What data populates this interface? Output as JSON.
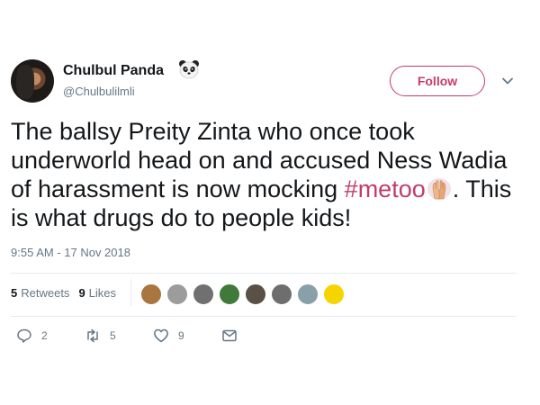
{
  "author": {
    "name": "Chulbul Panda",
    "name_emoji": "panda-face-icon",
    "handle": "@Chulbulilmli"
  },
  "follow_label": "Follow",
  "tweet": {
    "text_before": "The ballsy Preity Zinta who once took underworld head on and accused Ness Wadia of harassment is now mocking ",
    "hashtag": "#metoo",
    "hashtag_emoji": "raised-hands-icon",
    "text_after": ". This is what drugs do to people kids!"
  },
  "timestamp": "9:55 AM - 17 Nov 2018",
  "stats": {
    "retweets_count": "5",
    "retweets_label": "Retweets",
    "likes_count": "9",
    "likes_label": "Likes"
  },
  "likers": [
    {
      "icon": "liker-avatar-1",
      "color": "#a8763e"
    },
    {
      "icon": "liker-avatar-2",
      "color": "#9c9c9c"
    },
    {
      "icon": "liker-avatar-3",
      "color": "#707070"
    },
    {
      "icon": "liker-avatar-4",
      "color": "#3f7a3a"
    },
    {
      "icon": "liker-avatar-5",
      "color": "#5a5046"
    },
    {
      "icon": "liker-avatar-6",
      "color": "#6e6e6e"
    },
    {
      "icon": "liker-avatar-7",
      "color": "#8aa0a8"
    },
    {
      "icon": "liker-avatar-8",
      "color": "#f5d400"
    }
  ],
  "actions": {
    "reply_count": "2",
    "retweet_count": "5",
    "like_count": "9"
  },
  "colors": {
    "accent": "#c33b6c",
    "secondary_text": "#657786",
    "primary_text": "#14171a",
    "divider": "#e6ecf0"
  }
}
